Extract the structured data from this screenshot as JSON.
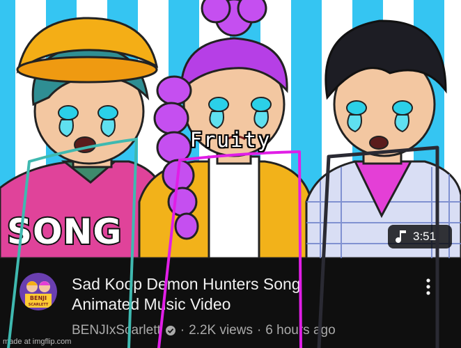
{
  "meme_caption": "Fruity",
  "thumbnail": {
    "overlay_text": "SONG",
    "duration": "3:51",
    "duration_icon": "music-note-icon"
  },
  "video": {
    "title_line1": "Sad Koop Demon Hunters Song",
    "title_line2": "Animated Music Video",
    "channel": "BENJIxScarlett",
    "views": "2.2K views",
    "separator": "·",
    "age": "6 hours ago",
    "verified_icon": "verified-check-icon",
    "menu_icon": "more-vertical-icon"
  },
  "avatar_text": {
    "line1": "BENJI",
    "line2": "SCARLETT"
  },
  "watermark": "made at imgflip.com",
  "colors": {
    "background": "#0f0f0f",
    "title": "#f1f1f1",
    "meta": "#aaaaaa",
    "stripe_light": "#ffffff",
    "stripe_blue": "#35c5f2",
    "teal_line": "#3fb9b0",
    "magenta_line": "#e01ee6",
    "dark_line": "#2a2a33"
  }
}
